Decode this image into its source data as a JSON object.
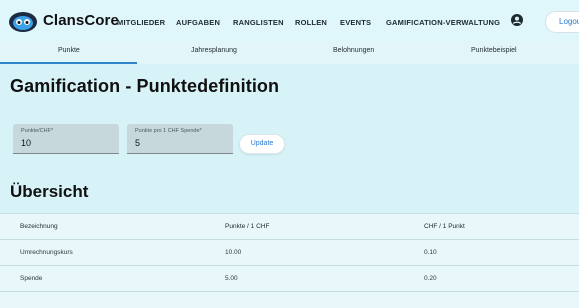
{
  "app": {
    "brand": "ClansCore",
    "logout_label": "Logout",
    "accent": "#2f84c9"
  },
  "nav": [
    "MITGLIEDER",
    "AUFGABEN",
    "RANGLISTEN",
    "ROLLEN",
    "EVENTS",
    "GAMIFICATION-VERWALTUNG"
  ],
  "tabs": [
    "Punkte",
    "Jahresplanung",
    "Belohnungen",
    "Punktebeispiel"
  ],
  "active_tab": "Punkte",
  "page_title": "Gamification - Punktedefinition",
  "form": {
    "fields": [
      {
        "label": "Punkte/CHF*",
        "value": "10"
      },
      {
        "label": "Punkte pro 1 CHF Spende*",
        "value": "5"
      }
    ],
    "update_label": "Update"
  },
  "overview": {
    "title": "Übersicht",
    "columns": [
      "Bezeichnung",
      "Punkte / 1 CHF",
      "CHF / 1 Punkt"
    ],
    "rows": [
      [
        "Umrechnungskurs",
        "10.00",
        "0.10"
      ],
      [
        "Spende",
        "5.00",
        "0.20"
      ]
    ]
  }
}
